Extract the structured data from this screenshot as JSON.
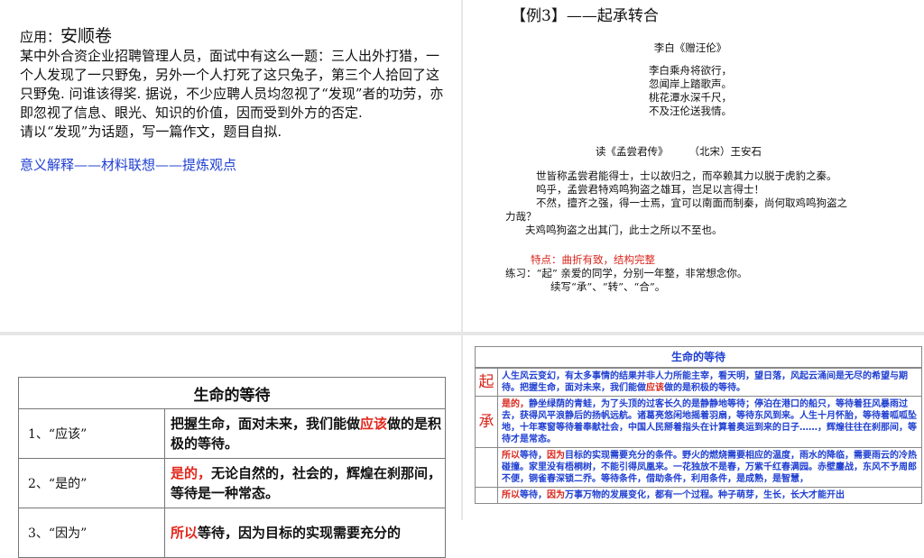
{
  "top_left": {
    "app_label": "应用：",
    "app_title": "安顺卷",
    "paragraph": "某中外合资企业招聘管理人员，面试中有这么一题：三人出外打猎，一个人发现了一只野兔，另外一个人打死了这只兔子，第三个人拾回了这只野兔. 问谁该得奖. 据说，不少应聘人员均忽视了“发现”者的功劳，亦即忽视了信息、眼光、知识的价值，因而受到外方的否定.",
    "instruction": "请以“发现”为话题，写一篇作文，题目自拟.",
    "method": "意义解释——材料联想——提炼观点"
  },
  "top_right": {
    "heading": "【例3】——起承转合",
    "poem_title": "李白《赠汪伦》",
    "poem_lines": [
      "李白乘舟将欲行，",
      "忽闻岸上踏歌声。",
      "桃花潭水深千尺，",
      "不及汪伦送我情。"
    ],
    "essay_title": "读《孟尝君传》　　　（北宋）王安石",
    "essay_lines": [
      "世皆称孟尝君能得士，士以故归之，而卒赖其力以脱于虎豹之秦。",
      "呜乎，孟尝君特鸡鸣狗盗之雄耳，岂足以言得士！",
      "不然，擅齐之强，得一士焉，宜可以南面而制秦，尚何取鸡鸣狗盗之",
      "力哉？",
      "夫鸡鸣狗盗之出其门，此士之所以不至也。"
    ],
    "feature": "特点：曲折有致，结构完整",
    "practice_1": "练习：“起” 亲爱的同学，分别一年整，非常想念你。",
    "practice_2": "续写“承”、“转”、“合”。"
  },
  "bottom_left": {
    "table_title": "生命的等待",
    "rows": [
      {
        "key": "1、“应该”",
        "pre": "把握生命，面对未来，我们能做",
        "red": "应该",
        "post": "做的是积极的等待。"
      },
      {
        "key": "2、“是的”",
        "pre": "",
        "red": "是的，",
        "post": "无论自然的，社会的，辉煌在刹那间，等待是一种常态。"
      },
      {
        "key": "3、“因为”",
        "pre": "",
        "red": "所以",
        "post": "等待，因为目标的实现需要充分的"
      }
    ]
  },
  "bottom_right": {
    "title": "生命的等待",
    "rows": [
      {
        "key": "起",
        "segments": [
          {
            "t": "人生风云变幻，有太多事情的结果并非人力所能主宰，看天明，望日落，风起云涌间是无尽的希望与期待。把握生命，面对未来，我们能做",
            "r": false
          },
          {
            "t": "应该",
            "r": true
          },
          {
            "t": "做的是积极的等待。",
            "r": false
          }
        ]
      },
      {
        "key": "承",
        "segments": [
          {
            "t": "是的，",
            "r": true
          },
          {
            "t": "静坐绿荫的青蛙，为了头顶的过客长久的是静静地等待；停泊在港口的船只，等待着狂风暴雨过去，获得风平浪静后的扬帆远航。诸葛亮悠闲地摇着羽扇，等待东风到来。人生十月怀胎，等待着呱呱坠地，十年寒窗等待着奉献社会，中国人民掰着指头在计算着奥运到来的日子……，辉煌往往在刹那间，等待才是常态。",
            "r": false
          }
        ]
      },
      {
        "key": "",
        "segments": [
          {
            "t": "所以",
            "r": true
          },
          {
            "t": "等待，",
            "r": false
          },
          {
            "t": "因为",
            "r": true
          },
          {
            "t": "目标的实现需要充分的条件。野火的燃烧需要相应的温度，雨水的降临，需要雨云的冷热碰撞。家里没有梧桐树，不能引得凤凰来。一花独放不是春，万紫千红春满园。赤壁鏖战，东风不予周郎不便，铜雀春深锁二乔。等待条件，借助条件，利用条件，是成熟，是智慧，",
            "r": false
          }
        ]
      },
      {
        "key": "",
        "segments": [
          {
            "t": "所以",
            "r": true
          },
          {
            "t": "等待，",
            "r": false
          },
          {
            "t": "因为",
            "r": true
          },
          {
            "t": "万事万物的发展变化，都有一个过程。种子萌芽，生长，长大才能开出",
            "r": false
          }
        ]
      }
    ]
  }
}
